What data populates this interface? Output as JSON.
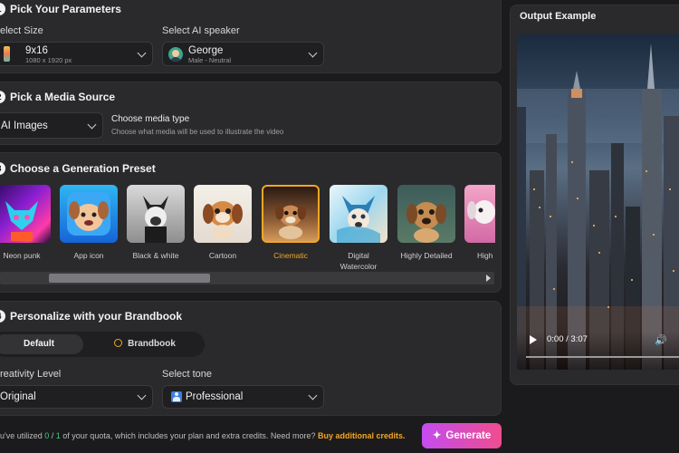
{
  "params": {
    "title": "Pick Your Parameters",
    "size_label": "elect Size",
    "size_value": "9x16",
    "size_sub": "1080 x 1920 px",
    "speaker_label": "Select AI speaker",
    "speaker_name": "George",
    "speaker_sub": "Male - Neutral"
  },
  "media": {
    "title": "Pick a Media Source",
    "value": "AI Images",
    "type_title": "Choose media type",
    "type_hint": "Choose what media will be used to illustrate the video"
  },
  "presets": {
    "title": "Choose a Generation Preset",
    "items": [
      {
        "label": "Neon punk"
      },
      {
        "label": "App icon"
      },
      {
        "label": "Black & white"
      },
      {
        "label": "Cartoon"
      },
      {
        "label": "Cinematic",
        "selected": true
      },
      {
        "label": "Digital Watercolor"
      },
      {
        "label": "Highly Detailed"
      },
      {
        "label": "High"
      }
    ],
    "scroll_fraction": 0.4
  },
  "brandbook": {
    "title": "Personalize with your Brandbook",
    "default_label": "Default",
    "brandbook_label": "Brandbook",
    "creativity_label": "reativity Level",
    "creativity_value": "Original",
    "tone_label": "Select tone",
    "tone_value": "Professional"
  },
  "footer": {
    "quota_prefix": "u've utilized ",
    "quota_used": "0",
    "quota_sep": " / ",
    "quota_total": "1",
    "quota_suffix": " of your quota, which includes your plan and extra credits. Need more? ",
    "buy_link": "Buy additional credits.",
    "generate_label": "Generate"
  },
  "output": {
    "title": "Output Example",
    "time": "0:00 / 3:07"
  },
  "colors": {
    "accent_orange": "#f5a623",
    "quota_green": "#3ccf7a",
    "generate_gradient_start": "#c44cf0",
    "generate_gradient_end": "#ef4d8e"
  }
}
